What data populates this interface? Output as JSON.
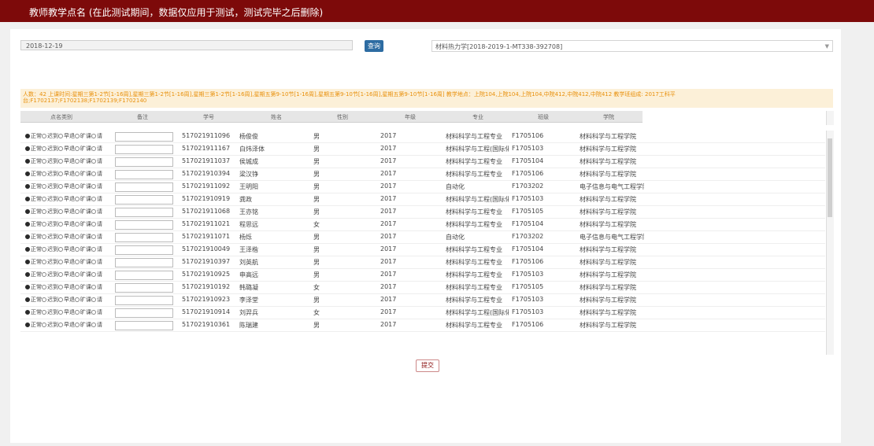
{
  "header": {
    "title": "教师教学点名 (在此测试期间，数据仅应用于测试，测试完毕之后删除)"
  },
  "filters": {
    "date": "2018-12-19",
    "query_label": "查询",
    "course": "材料热力学[2018-2019-1-MT338-392708]"
  },
  "info": {
    "line1": "人数：42 上课时间:星期三第1-2节[1-16周],星期三第1-2节[1-16周],星期三第1-2节[1-16周],星期五第9-10节[1-16周],星期五第9-10节[1-16周],星期五第9-10节[1-16周] 教学地点：上院104,上院104,上院104,中院412,中院412,中院412 教学班组成: 2017工科平",
    "line2": "台;F1702137;F1702138;F1702139;F1702140"
  },
  "table": {
    "headers": [
      "点名类别",
      "备注",
      "学号",
      "姓名",
      "性别",
      "年级",
      "专业",
      "班级",
      "学院"
    ],
    "status_options": [
      "正常",
      "迟到",
      "早退",
      "旷课",
      "请"
    ],
    "rows": [
      [
        "517021911096",
        "杨俊俊",
        "男",
        "2017",
        "材料科学与工程专业",
        "F1705106",
        "材料科学与工程学院"
      ],
      [
        "517021911167",
        "白炜泽体",
        "男",
        "2017",
        "材料科学与工程(国际化",
        "F1705103",
        "材料科学与工程学院"
      ],
      [
        "517021911037",
        "侯城成",
        "男",
        "2017",
        "材料科学与工程专业",
        "F1705104",
        "材料科学与工程学院"
      ],
      [
        "517021910394",
        "梁汉铮",
        "男",
        "2017",
        "材料科学与工程专业",
        "F1705106",
        "材料科学与工程学院"
      ],
      [
        "517021911092",
        "王明阳",
        "男",
        "2017",
        "自动化",
        "F1703202",
        "电子信息与电气工程学院"
      ],
      [
        "517021910919",
        "龚政",
        "男",
        "2017",
        "材料科学与工程(国际化",
        "F1705103",
        "材料科学与工程学院"
      ],
      [
        "517021911068",
        "王亦铭",
        "男",
        "2017",
        "材料科学与工程专业",
        "F1705105",
        "材料科学与工程学院"
      ],
      [
        "517021911021",
        "程思远",
        "女",
        "2017",
        "材料科学与工程专业",
        "F1705104",
        "材料科学与工程学院"
      ],
      [
        "517021911071",
        "杨烁",
        "男",
        "2017",
        "自动化",
        "F1703202",
        "电子信息与电气工程学院"
      ],
      [
        "517021910049",
        "王泽楷",
        "男",
        "2017",
        "材料科学与工程专业",
        "F1705104",
        "材料科学与工程学院"
      ],
      [
        "517021910397",
        "刘英航",
        "男",
        "2017",
        "材料科学与工程专业",
        "F1705106",
        "材料科学与工程学院"
      ],
      [
        "517021910925",
        "申高远",
        "男",
        "2017",
        "材料科学与工程专业",
        "F1705103",
        "材料科学与工程学院"
      ],
      [
        "517021910192",
        "韩璐凝",
        "女",
        "2017",
        "材料科学与工程专业",
        "F1705105",
        "材料科学与工程学院"
      ],
      [
        "517021910923",
        "李泽堂",
        "男",
        "2017",
        "材料科学与工程专业",
        "F1705103",
        "材料科学与工程学院"
      ],
      [
        "517021910914",
        "刘羿兵",
        "女",
        "2017",
        "材料科学与工程(国际化",
        "F1705103",
        "材料科学与工程学院"
      ],
      [
        "517021910361",
        "陈瑞建",
        "男",
        "2017",
        "材料科学与工程专业",
        "F1705106",
        "材料科学与工程学院"
      ]
    ]
  },
  "submit_label": "提交",
  "colors": {
    "brand": "#7d0a0a",
    "info_text": "#e8900c",
    "info_bg": "#fcf0d8",
    "query_btn": "#2d6ca2"
  }
}
